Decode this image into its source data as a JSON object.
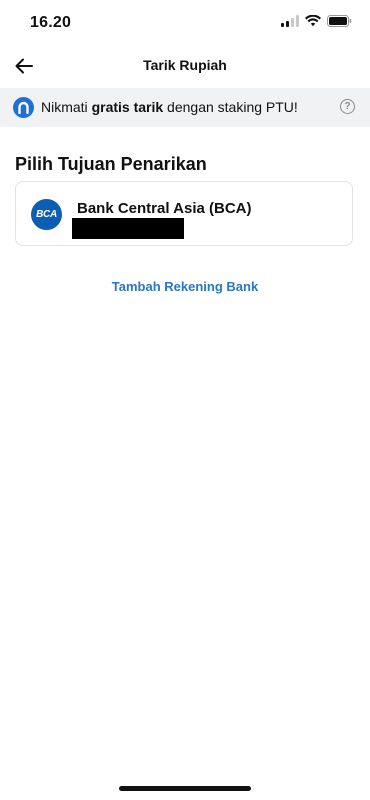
{
  "status_bar": {
    "time": "16.20"
  },
  "nav": {
    "title": "Tarik Rupiah"
  },
  "promo": {
    "text_prefix": "Nikmati ",
    "text_bold": "gratis tarik",
    "text_suffix": " dengan staking PTU!",
    "help_glyph": "?"
  },
  "section": {
    "title": "Pilih Tujuan Penarikan"
  },
  "bank_accounts": [
    {
      "logo_text": "BCA",
      "name": "Bank Central Asia (BCA)"
    }
  ],
  "actions": {
    "add_bank_label": "Tambah Rekening Bank"
  },
  "colors": {
    "accent": "#2a76c8",
    "bca_blue": "#0c5eb5",
    "promo_bg": "#f1f2f4"
  },
  "icons": {
    "back": "arrow-left-icon",
    "help": "question-circle-icon",
    "promo": "pintu-logo-icon",
    "signal": "cellular-signal-icon",
    "wifi": "wifi-icon",
    "battery": "battery-icon"
  }
}
